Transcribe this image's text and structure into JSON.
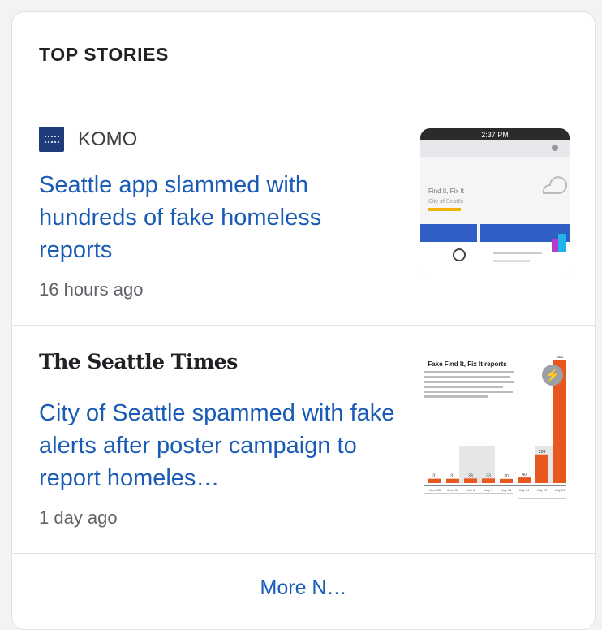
{
  "section": {
    "title": "TOP STORIES"
  },
  "stories": [
    {
      "source": "KOMO",
      "logo_icon": "komo-logo",
      "headline": "Seattle app slammed with hundreds of fake homeless reports",
      "time": "16 hours ago",
      "thumbnail": {
        "header_time": "2:37 PM",
        "app_title": "Find It, Fix It",
        "app_subtitle": "City of Seattle"
      }
    },
    {
      "source": "The Seattle Times",
      "headline": "City of Seattle spammed with fake alerts after poster campaign to report homeles…",
      "time": "1 day ago",
      "thumbnail": {
        "icon": "amp-lightning-icon",
        "chart_title": "Fake Find It, Fix It reports",
        "bar_values": [
          31,
          31,
          33,
          33,
          30,
          40,
          204,
          880
        ],
        "bar_labels": [
          "31",
          "31",
          "33",
          "33",
          "30",
          "40",
          "204",
          "880"
        ],
        "date_labels": [
          "June 28",
          "June 30",
          "July 6",
          "July 7",
          "July 13",
          "July 14",
          "July 20",
          "July 21"
        ]
      }
    }
  ],
  "more_link": "More N…",
  "colors": {
    "link": "#1a5bb5",
    "bar": "#e8571e",
    "komo": "#1f3c7a"
  }
}
